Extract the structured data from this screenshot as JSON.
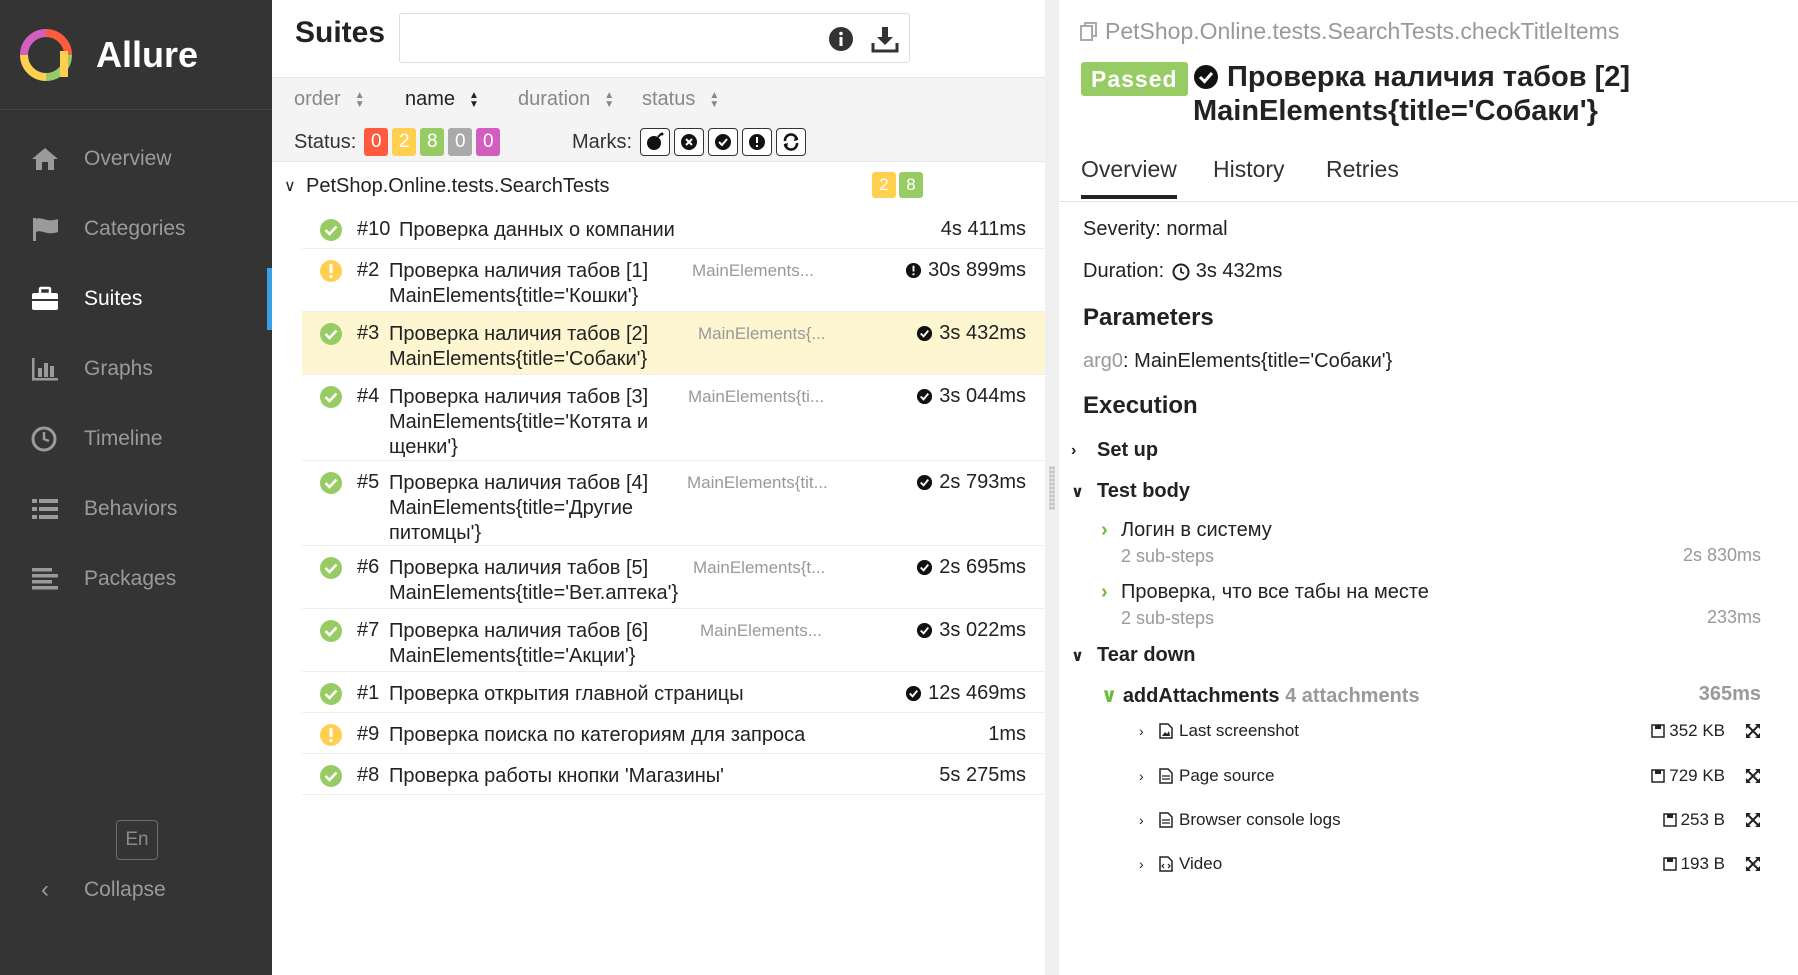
{
  "app": {
    "name": "Allure"
  },
  "sidebar": {
    "items": [
      {
        "label": "Overview",
        "icon": "home-icon"
      },
      {
        "label": "Categories",
        "icon": "flag-icon"
      },
      {
        "label": "Suites",
        "icon": "briefcase-icon",
        "active": true
      },
      {
        "label": "Graphs",
        "icon": "bar-chart-icon"
      },
      {
        "label": "Timeline",
        "icon": "clock-icon"
      },
      {
        "label": "Behaviors",
        "icon": "list-icon"
      },
      {
        "label": "Packages",
        "icon": "align-left-icon"
      }
    ],
    "lang": "En",
    "collapse": "Collapse"
  },
  "suites": {
    "title": "Suites",
    "search_value": "",
    "sort": [
      "order",
      "name",
      "duration",
      "status"
    ],
    "status_label": "Status:",
    "status_counts": [
      {
        "value": "0",
        "color": "#fd5a3e"
      },
      {
        "value": "2",
        "color": "#ffd050"
      },
      {
        "value": "8",
        "color": "#97cc64"
      },
      {
        "value": "0",
        "color": "#aaaaaa"
      },
      {
        "value": "0",
        "color": "#d35ebe"
      }
    ],
    "marks_label": "Marks:",
    "group": {
      "name": "PetShop.Online.tests.SearchTests",
      "counts": [
        {
          "value": "2",
          "color": "#ffd050"
        },
        {
          "value": "8",
          "color": "#97cc64"
        }
      ]
    },
    "rows": [
      {
        "num": "#10",
        "name": "Проверка данных о компании",
        "param": "",
        "duration": "4s 411ms",
        "status": "passed"
      },
      {
        "num": "#2",
        "name": "Проверка наличия табов [1] MainElements{title='Кошки'}",
        "param": "MainElements...",
        "duration": "30s 899ms",
        "status": "broken"
      },
      {
        "num": "#3",
        "name": "Проверка наличия табов [2] MainElements{title='Собаки'}",
        "param": "MainElements{...",
        "duration": "3s 432ms",
        "status": "passed",
        "selected": true
      },
      {
        "num": "#4",
        "name": "Проверка наличия табов [3] MainElements{title='Котята и щенки'}",
        "param": "MainElements{ti...",
        "duration": "3s 044ms",
        "status": "passed"
      },
      {
        "num": "#5",
        "name": "Проверка наличия табов [4] MainElements{title='Другие питомцы'}",
        "param": "MainElements{tit...",
        "duration": "2s 793ms",
        "status": "passed"
      },
      {
        "num": "#6",
        "name": "Проверка наличия табов [5] MainElements{title='Вет.аптека'}",
        "param": "MainElements{t...",
        "duration": "2s 695ms",
        "status": "passed"
      },
      {
        "num": "#7",
        "name": "Проверка наличия табов [6] MainElements{title='Акции'}",
        "param": "MainElements...",
        "duration": "3s 022ms",
        "status": "passed"
      },
      {
        "num": "#1",
        "name": "Проверка открытия главной страницы",
        "param": "",
        "duration": "12s 469ms",
        "status": "passed"
      },
      {
        "num": "#9",
        "name": "Проверка поиска по категориям для запроса",
        "param": "",
        "duration": "1ms",
        "status": "broken"
      },
      {
        "num": "#8",
        "name": "Проверка работы кнопки 'Магазины'",
        "param": "",
        "duration": "5s 275ms",
        "status": "passed"
      }
    ]
  },
  "detail": {
    "fullname": "PetShop.Online.tests.SearchTests.checkTitleItems",
    "status": "Passed",
    "title": "Проверка наличия табов [2] MainElements{title='Собаки'}",
    "tabs": [
      "Overview",
      "History",
      "Retries"
    ],
    "severity_label": "Severity:",
    "severity": "normal",
    "duration_label": "Duration:",
    "duration": "3s 432ms",
    "parameters_title": "Parameters",
    "param_name": "arg0",
    "param_value": "MainElements{title='Собаки'}",
    "execution_title": "Execution",
    "setup": "Set up",
    "test_body": "Test body",
    "steps": [
      {
        "name": "Логин в систему",
        "sub": "2 sub-steps",
        "time": "2s 830ms"
      },
      {
        "name": "Проверка, что все табы на месте",
        "sub": "2 sub-steps",
        "time": "233ms"
      }
    ],
    "teardown": "Tear down",
    "add_attachments": {
      "name": "addAttachments",
      "count": "4 attachments",
      "time": "365ms"
    },
    "attachments": [
      {
        "name": "Last screenshot",
        "size": "352 KB",
        "icon": "image-file-icon"
      },
      {
        "name": "Page source",
        "size": "729 KB",
        "icon": "text-file-icon"
      },
      {
        "name": "Browser console logs",
        "size": "253 B",
        "icon": "text-file-icon"
      },
      {
        "name": "Video",
        "size": "193 B",
        "icon": "code-file-icon"
      }
    ]
  }
}
